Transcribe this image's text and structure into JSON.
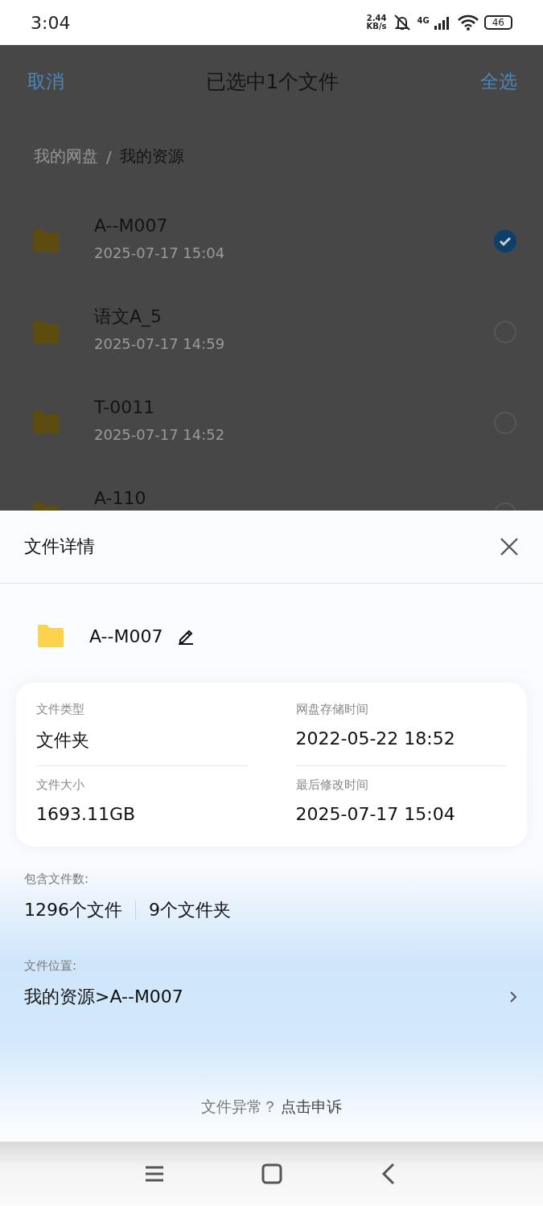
{
  "status_bar": {
    "time": "3:04",
    "net_speed_value": "2.44",
    "net_speed_unit": "KB/s",
    "network": "4G",
    "battery": "46"
  },
  "header": {
    "cancel": "取消",
    "title": "已选中1个文件",
    "select_all": "全选"
  },
  "breadcrumb_separator": "/",
  "breadcrumbs": [
    {
      "label": "我的网盘",
      "current": false
    },
    {
      "label": "我的资源",
      "current": true
    }
  ],
  "files": [
    {
      "name": "A--M007",
      "date": "2025-07-17  15:04",
      "selected": true
    },
    {
      "name": "语文A_5",
      "date": "2025-07-17  14:59",
      "selected": false
    },
    {
      "name": "T-0011",
      "date": "2025-07-17  14:52",
      "selected": false
    },
    {
      "name": "A-110",
      "selected": false
    }
  ],
  "details_sheet": {
    "title": "文件详情",
    "file_name": "A--M007",
    "info": [
      {
        "label": "文件类型",
        "value": "文件夹"
      },
      {
        "label": "网盘存储时间",
        "value": "2022-05-22 18:52"
      },
      {
        "label": "文件大小",
        "value": "1693.11GB"
      },
      {
        "label": "最后修改时间",
        "value": "2025-07-17 15:04"
      }
    ],
    "contains_label": "包含文件数:",
    "file_count": "1296个文件",
    "folder_count": "9个文件夹",
    "location_label": "文件位置:",
    "location": "我的资源>A--M007",
    "appeal_prompt": "文件异常？",
    "appeal_link": "点击申诉"
  }
}
